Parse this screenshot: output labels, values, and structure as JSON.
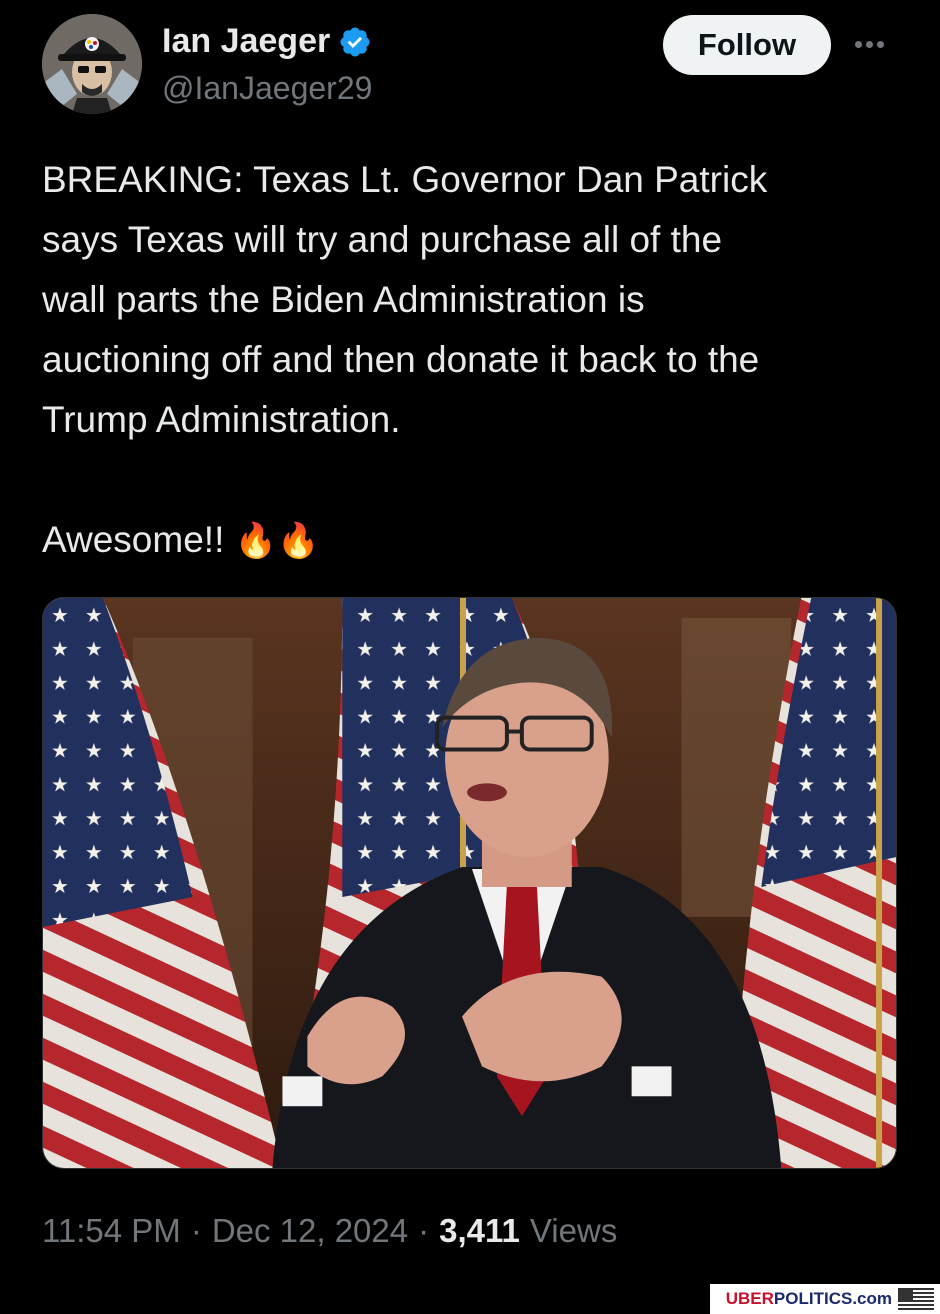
{
  "author": {
    "display_name": "Ian Jaeger",
    "handle": "@IanJaeger29",
    "verified": true,
    "avatar_icon": "avatar-photo"
  },
  "follow_label": "Follow",
  "tweet": {
    "lines": [
      "BREAKING: Texas Lt. Governor Dan Patrick",
      "says Texas will try and purchase all of the",
      "wall parts the Biden Administration is",
      "auctioning off and then donate it back to the",
      "Trump Administration."
    ],
    "closing": "Awesome!!",
    "emoji": "🔥🔥"
  },
  "meta": {
    "time": "11:54 PM",
    "date": "Dec 12, 2024",
    "views_count": "3,411",
    "views_label": "Views"
  },
  "watermark": {
    "uber": "UBER",
    "politics": "POLITICS.com"
  },
  "colors": {
    "background": "#000000",
    "text": "#e7e9ea",
    "muted": "#71767b",
    "verified": "#1d9bf0",
    "follow_bg": "#eff3f4"
  }
}
